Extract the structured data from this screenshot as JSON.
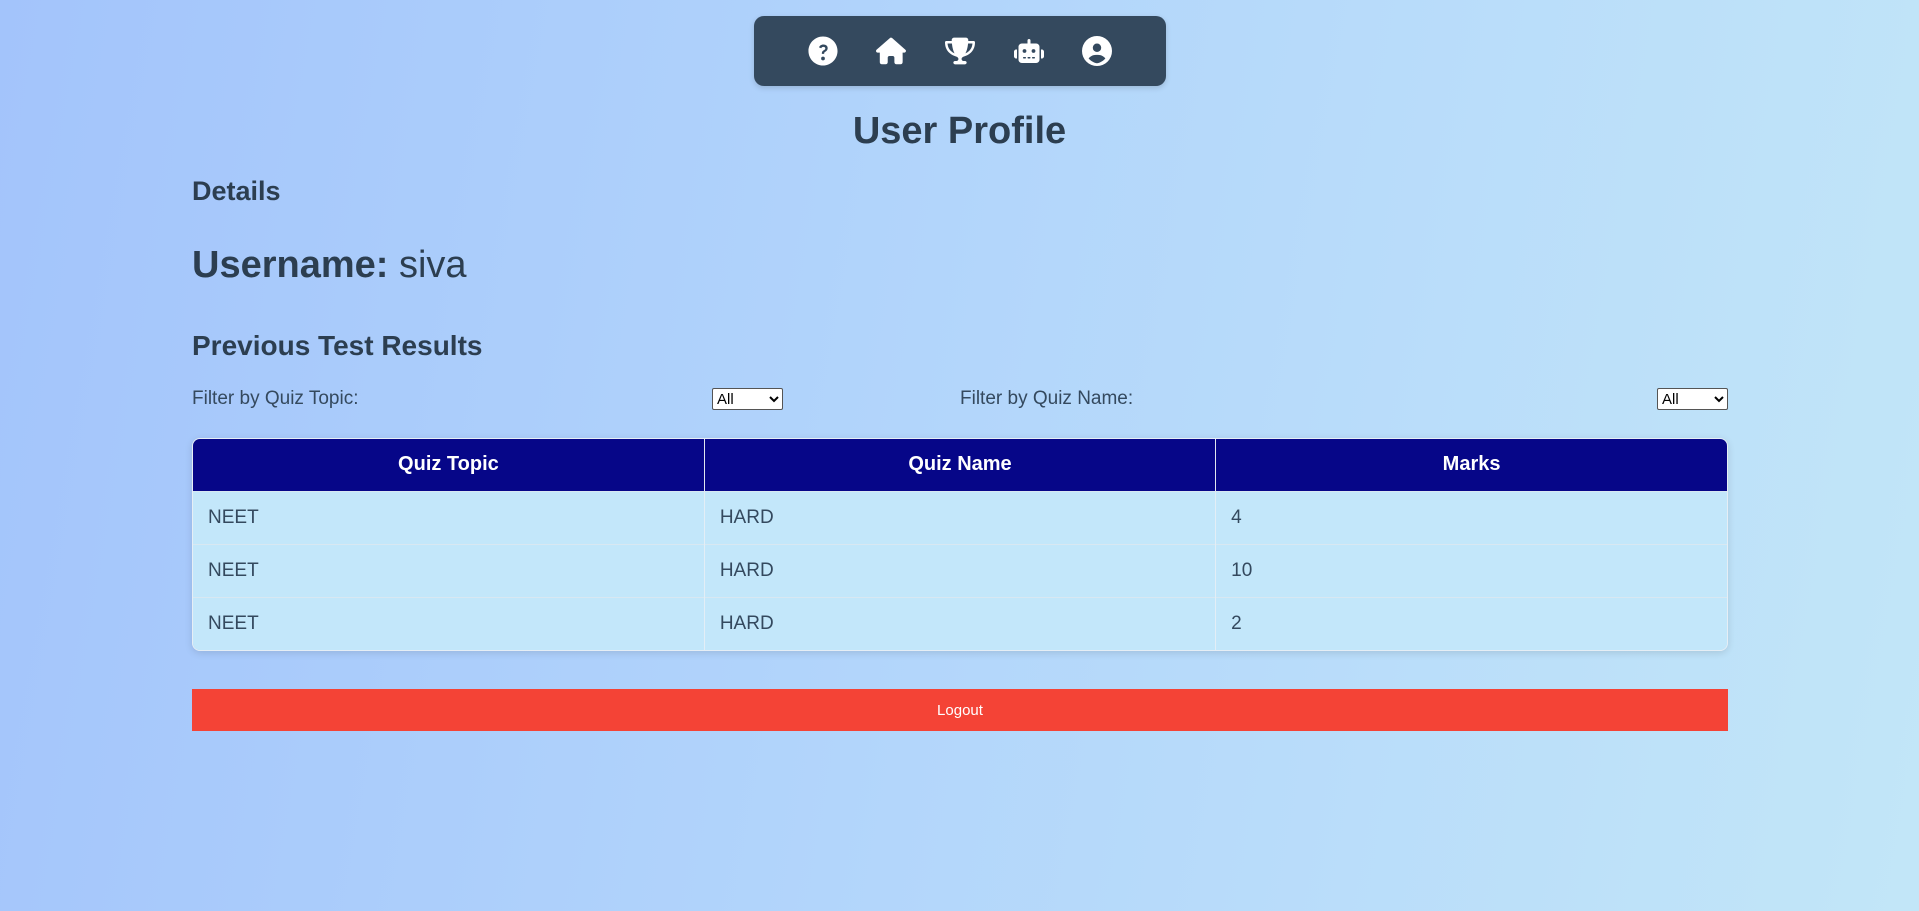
{
  "nav": {
    "items": [
      {
        "name": "help",
        "icon": "question-circle-icon"
      },
      {
        "name": "home",
        "icon": "home-icon"
      },
      {
        "name": "leaderboard",
        "icon": "trophy-icon"
      },
      {
        "name": "bot",
        "icon": "robot-icon"
      },
      {
        "name": "profile",
        "icon": "user-circle-icon"
      }
    ]
  },
  "page": {
    "title": "User Profile",
    "details_heading": "Details",
    "username_label": "Username:",
    "username_value": "siva",
    "results_heading": "Previous Test Results"
  },
  "filters": {
    "topic_label": "Filter by Quiz Topic:",
    "topic_selected": "All",
    "name_label": "Filter by Quiz Name:",
    "name_selected": "All"
  },
  "table": {
    "headers": [
      "Quiz Topic",
      "Quiz Name",
      "Marks"
    ],
    "rows": [
      [
        "NEET",
        "HARD",
        "4"
      ],
      [
        "NEET",
        "HARD",
        "10"
      ],
      [
        "NEET",
        "HARD",
        "2"
      ]
    ]
  },
  "actions": {
    "logout_label": "Logout"
  },
  "colors": {
    "navbar": "#34495e",
    "table_header": "#060688",
    "table_row": "#c3e7fa",
    "logout": "#f44336",
    "text": "#2c3e50"
  }
}
